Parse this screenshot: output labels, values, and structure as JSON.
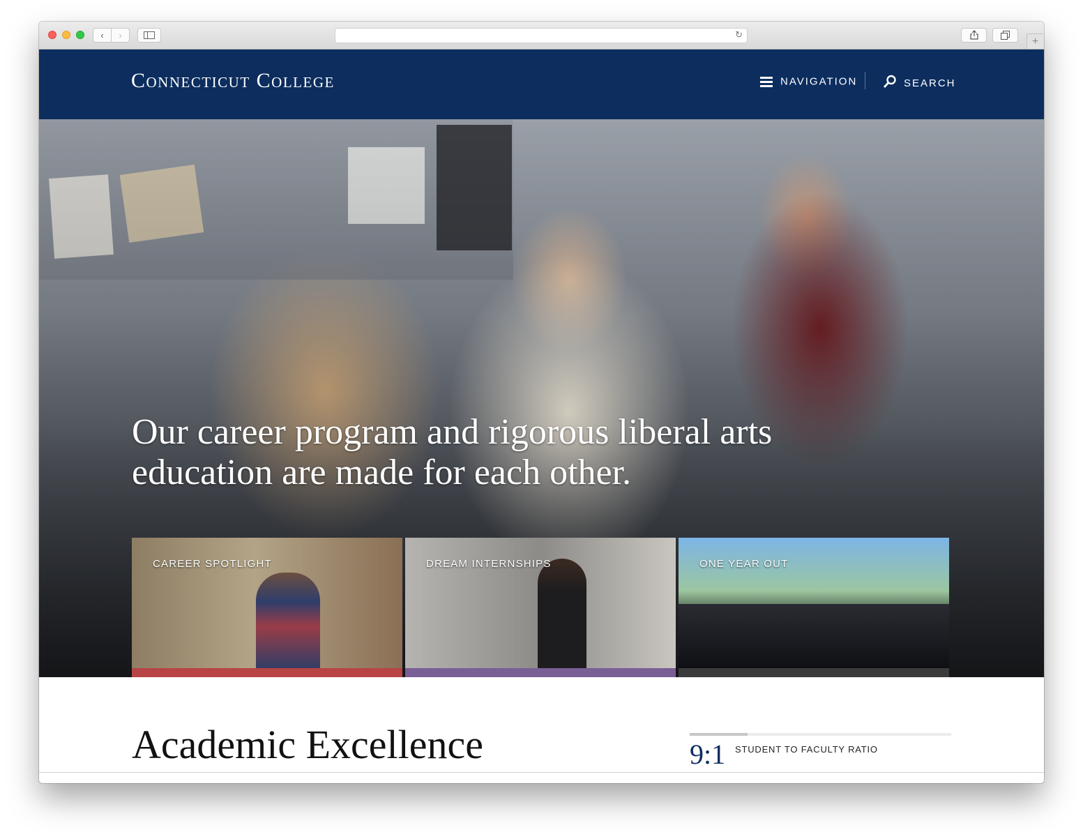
{
  "browser": {
    "back_label": "‹",
    "forward_label": "›",
    "reload_label": "↻",
    "new_tab_label": "+"
  },
  "header": {
    "logo": "Connecticut College",
    "nav_label": "NAVIGATION",
    "search_label": "SEARCH",
    "background_color": "#0c2d5e"
  },
  "hero": {
    "headline_line1": "Our career program and rigorous liberal arts",
    "headline_line2": "education are made for each other."
  },
  "cards": [
    {
      "label": "Career Spotlight",
      "bar_color": "#b84445"
    },
    {
      "label": "Dream Internships",
      "bar_color": "#7a5f96"
    },
    {
      "label": "One Year Out",
      "bar_color": "#3b3b3b"
    }
  ],
  "section": {
    "heading": "Academic Excellence"
  },
  "stat": {
    "value": "9:1",
    "label": "STUDENT TO FACULTY RATIO",
    "progress_fraction": 0.22
  }
}
